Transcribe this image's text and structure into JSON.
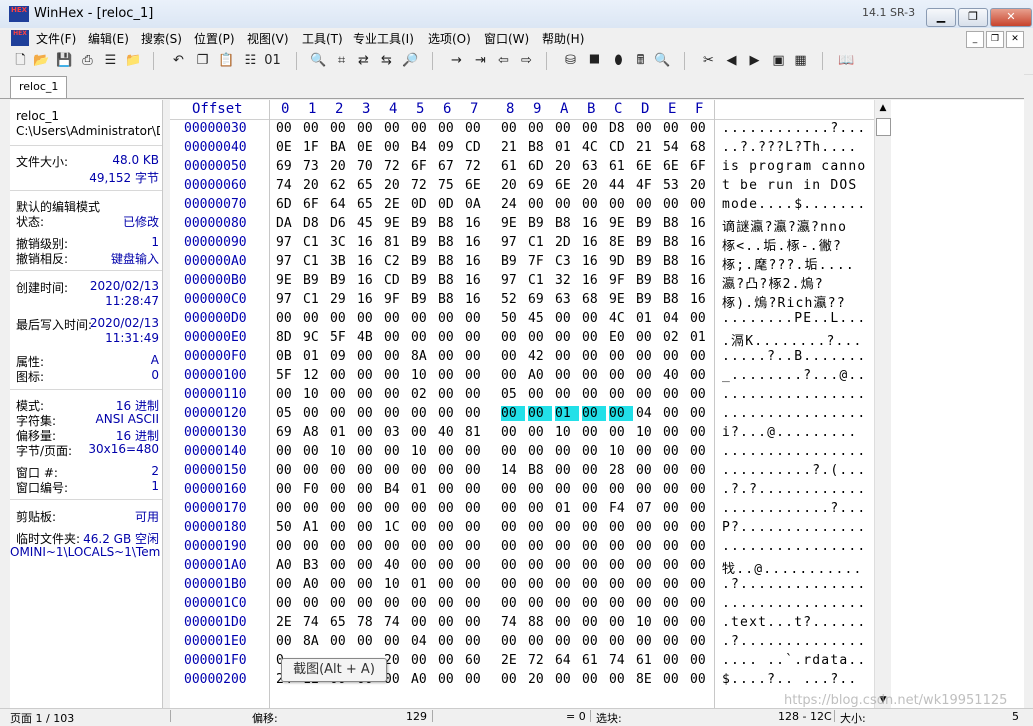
{
  "window": {
    "title": "WinHex - [reloc_1]",
    "version": "14.1 SR-3",
    "icon_text_top": "HEX",
    "icon_text_bottom": "WinHex"
  },
  "menu": [
    "文件(F)",
    "编辑(E)",
    "搜索(S)",
    "位置(P)",
    "视图(V)",
    "工具(T)",
    "专业工具(I)",
    "选项(O)",
    "窗口(W)",
    "帮助(H)"
  ],
  "tab": {
    "label": "reloc_1"
  },
  "info": {
    "filename": "reloc_1",
    "path": "C:\\Users\\Administrator\\De",
    "filesize_label": "文件大小:",
    "filesize_kb": "48.0 KB",
    "filesize_bytes": "49,152 字节",
    "edit_mode_label": "默认的编辑模式",
    "state_label": "状态:",
    "state_value": "已修改",
    "undo_level_label": "撤销级别:",
    "undo_level_value": "1",
    "undo_reverse_label": "撤销相反:",
    "undo_reverse_value": "键盘输入",
    "created_label": "创建时间:",
    "created_date": "2020/02/13",
    "created_time": "11:28:47",
    "modified_label": "最后写入时间:",
    "modified_date": "2020/02/13",
    "modified_time": "11:31:49",
    "attr_label": "属性:",
    "attr_value": "A",
    "icon_label": "图标:",
    "icon_value": "0",
    "mode_label": "模式:",
    "mode_value": "16 进制",
    "charset_label": "字符集:",
    "charset_value": "ANSI ASCII",
    "offset_label": "偏移量:",
    "offset_value": "16 进制",
    "bytes_page_label": "字节/页面:",
    "bytes_page_value": "30x16=480",
    "window_no_label": "窗口 #:",
    "window_no_value": "2",
    "window_num_label": "窗口编号:",
    "window_num_value": "1",
    "clipboard_label": "剪贴板:",
    "clipboard_value": "可用",
    "temp_label": "临时文件夹:",
    "temp_value": "46.2 GB 空闲",
    "temp_path": "OMINI~1\\LOCALS~1\\Temp"
  },
  "hex": {
    "header_offset": "Offset",
    "columns": [
      "0",
      "1",
      "2",
      "3",
      "4",
      "5",
      "6",
      "7",
      "8",
      "9",
      "A",
      "B",
      "C",
      "D",
      "E",
      "F"
    ],
    "rows": [
      {
        "offset": "00000030",
        "bytes": [
          "00",
          "00",
          "00",
          "00",
          "00",
          "00",
          "00",
          "00",
          "00",
          "00",
          "00",
          "00",
          "D8",
          "00",
          "00",
          "00"
        ],
        "ascii": "............?..."
      },
      {
        "offset": "00000040",
        "bytes": [
          "0E",
          "1F",
          "BA",
          "0E",
          "00",
          "B4",
          "09",
          "CD",
          "21",
          "B8",
          "01",
          "4C",
          "CD",
          "21",
          "54",
          "68"
        ],
        "ascii": "..?.???L?Th...."
      },
      {
        "offset": "00000050",
        "bytes": [
          "69",
          "73",
          "20",
          "70",
          "72",
          "6F",
          "67",
          "72",
          "61",
          "6D",
          "20",
          "63",
          "61",
          "6E",
          "6E",
          "6F"
        ],
        "ascii": "is program canno"
      },
      {
        "offset": "00000060",
        "bytes": [
          "74",
          "20",
          "62",
          "65",
          "20",
          "72",
          "75",
          "6E",
          "20",
          "69",
          "6E",
          "20",
          "44",
          "4F",
          "53",
          "20"
        ],
        "ascii": "t be run in DOS "
      },
      {
        "offset": "00000070",
        "bytes": [
          "6D",
          "6F",
          "64",
          "65",
          "2E",
          "0D",
          "0D",
          "0A",
          "24",
          "00",
          "00",
          "00",
          "00",
          "00",
          "00",
          "00"
        ],
        "ascii": "mode....$......."
      },
      {
        "offset": "00000080",
        "bytes": [
          "DA",
          "D8",
          "D6",
          "45",
          "9E",
          "B9",
          "B8",
          "16",
          "9E",
          "B9",
          "B8",
          "16",
          "9E",
          "B9",
          "B8",
          "16"
        ],
        "ascii": "谪謎瀛?瀛?瀛?nno"
      },
      {
        "offset": "00000090",
        "bytes": [
          "97",
          "C1",
          "3C",
          "16",
          "81",
          "B9",
          "B8",
          "16",
          "97",
          "C1",
          "2D",
          "16",
          "8E",
          "B9",
          "B8",
          "16"
        ],
        "ascii": "椓<..垢.椓-.徶?"
      },
      {
        "offset": "000000A0",
        "bytes": [
          "97",
          "C1",
          "3B",
          "16",
          "C2",
          "B9",
          "B8",
          "16",
          "B9",
          "7F",
          "C3",
          "16",
          "9D",
          "B9",
          "B8",
          "16"
        ],
        "ascii": "椓;.麾???.垢...."
      },
      {
        "offset": "000000B0",
        "bytes": [
          "9E",
          "B9",
          "B9",
          "16",
          "CD",
          "B9",
          "B8",
          "16",
          "97",
          "C1",
          "32",
          "16",
          "9F",
          "B9",
          "B8",
          "16"
        ],
        "ascii": "瀛?凸?椓2.熓?"
      },
      {
        "offset": "000000C0",
        "bytes": [
          "97",
          "C1",
          "29",
          "16",
          "9F",
          "B9",
          "B8",
          "16",
          "52",
          "69",
          "63",
          "68",
          "9E",
          "B9",
          "B8",
          "16"
        ],
        "ascii": "椓).熓?Rich瀛??"
      },
      {
        "offset": "000000D0",
        "bytes": [
          "00",
          "00",
          "00",
          "00",
          "00",
          "00",
          "00",
          "00",
          "50",
          "45",
          "00",
          "00",
          "4C",
          "01",
          "04",
          "00"
        ],
        "ascii": "........PE..L..."
      },
      {
        "offset": "000000E0",
        "bytes": [
          "8D",
          "9C",
          "5F",
          "4B",
          "00",
          "00",
          "00",
          "00",
          "00",
          "00",
          "00",
          "00",
          "E0",
          "00",
          "02",
          "01"
        ],
        "ascii": ".滆K........?..."
      },
      {
        "offset": "000000F0",
        "bytes": [
          "0B",
          "01",
          "09",
          "00",
          "00",
          "8A",
          "00",
          "00",
          "00",
          "42",
          "00",
          "00",
          "00",
          "00",
          "00",
          "00"
        ],
        "ascii": ".....?..B......."
      },
      {
        "offset": "00000100",
        "bytes": [
          "5F",
          "12",
          "00",
          "00",
          "00",
          "10",
          "00",
          "00",
          "00",
          "A0",
          "00",
          "00",
          "00",
          "00",
          "40",
          "00"
        ],
        "ascii": "_........?...@.."
      },
      {
        "offset": "00000110",
        "bytes": [
          "00",
          "10",
          "00",
          "00",
          "00",
          "02",
          "00",
          "00",
          "05",
          "00",
          "00",
          "00",
          "00",
          "00",
          "00",
          "00"
        ],
        "ascii": "................"
      },
      {
        "offset": "00000120",
        "bytes": [
          "05",
          "00",
          "00",
          "00",
          "00",
          "00",
          "00",
          "00",
          "00",
          "00",
          "01",
          "00",
          "00",
          "04",
          "00",
          "00"
        ],
        "ascii": "................"
      },
      {
        "offset": "00000130",
        "bytes": [
          "69",
          "A8",
          "01",
          "00",
          "03",
          "00",
          "40",
          "81",
          "00",
          "00",
          "10",
          "00",
          "00",
          "10",
          "00",
          "00"
        ],
        "ascii": "i?...@........."
      },
      {
        "offset": "00000140",
        "bytes": [
          "00",
          "00",
          "10",
          "00",
          "00",
          "10",
          "00",
          "00",
          "00",
          "00",
          "00",
          "00",
          "10",
          "00",
          "00",
          "00"
        ],
        "ascii": "................"
      },
      {
        "offset": "00000150",
        "bytes": [
          "00",
          "00",
          "00",
          "00",
          "00",
          "00",
          "00",
          "00",
          "14",
          "B8",
          "00",
          "00",
          "28",
          "00",
          "00",
          "00"
        ],
        "ascii": "..........?.(..."
      },
      {
        "offset": "00000160",
        "bytes": [
          "00",
          "F0",
          "00",
          "00",
          "B4",
          "01",
          "00",
          "00",
          "00",
          "00",
          "00",
          "00",
          "00",
          "00",
          "00",
          "00"
        ],
        "ascii": ".?.?............"
      },
      {
        "offset": "00000170",
        "bytes": [
          "00",
          "00",
          "00",
          "00",
          "00",
          "00",
          "00",
          "00",
          "00",
          "00",
          "01",
          "00",
          "F4",
          "07",
          "00",
          "00"
        ],
        "ascii": "............?..."
      },
      {
        "offset": "00000180",
        "bytes": [
          "50",
          "A1",
          "00",
          "00",
          "1C",
          "00",
          "00",
          "00",
          "00",
          "00",
          "00",
          "00",
          "00",
          "00",
          "00",
          "00"
        ],
        "ascii": "P?.............."
      },
      {
        "offset": "00000190",
        "bytes": [
          "00",
          "00",
          "00",
          "00",
          "00",
          "00",
          "00",
          "00",
          "00",
          "00",
          "00",
          "00",
          "00",
          "00",
          "00",
          "00"
        ],
        "ascii": "................"
      },
      {
        "offset": "000001A0",
        "bytes": [
          "A0",
          "B3",
          "00",
          "00",
          "40",
          "00",
          "00",
          "00",
          "00",
          "00",
          "00",
          "00",
          "00",
          "00",
          "00",
          "00"
        ],
        "ascii": "牫..@..........."
      },
      {
        "offset": "000001B0",
        "bytes": [
          "00",
          "A0",
          "00",
          "00",
          "10",
          "01",
          "00",
          "00",
          "00",
          "00",
          "00",
          "00",
          "00",
          "00",
          "00",
          "00"
        ],
        "ascii": ".?.............."
      },
      {
        "offset": "000001C0",
        "bytes": [
          "00",
          "00",
          "00",
          "00",
          "00",
          "00",
          "00",
          "00",
          "00",
          "00",
          "00",
          "00",
          "00",
          "00",
          "00",
          "00"
        ],
        "ascii": "................"
      },
      {
        "offset": "000001D0",
        "bytes": [
          "2E",
          "74",
          "65",
          "78",
          "74",
          "00",
          "00",
          "00",
          "74",
          "88",
          "00",
          "00",
          "00",
          "10",
          "00",
          "00"
        ],
        "ascii": ".text...t?......"
      },
      {
        "offset": "000001E0",
        "bytes": [
          "00",
          "8A",
          "00",
          "00",
          "00",
          "04",
          "00",
          "00",
          "00",
          "00",
          "00",
          "00",
          "00",
          "00",
          "00",
          "00"
        ],
        "ascii": ".?.............."
      },
      {
        "offset": "000001F0",
        "bytes": [
          "0",
          "",
          "",
          "",
          "20",
          "00",
          "00",
          "60",
          "2E",
          "72",
          "64",
          "61",
          "74",
          "61",
          "00",
          "00"
        ],
        "ascii": ".... ..`.rdata.."
      },
      {
        "offset": "00000200",
        "bytes": [
          "24",
          "1E",
          "00",
          "00",
          "00",
          "A0",
          "00",
          "00",
          "00",
          "20",
          "00",
          "00",
          "00",
          "8E",
          "00",
          "00"
        ],
        "ascii": "$....?.. ...?.."
      }
    ]
  },
  "tooltip": "截图(Alt + A)",
  "status": {
    "page": "页面 1 / 103",
    "offset_label": "偏移:",
    "offset_value": "129",
    "equal": "= 0",
    "selection_label": "选块:",
    "range": "128 - 12C",
    "size_label": "大小:",
    "size_value": "5"
  },
  "watermark": "https://blog.csdn.net/wk19951125",
  "colors": {
    "selection": "#22e0e8",
    "offset_text": "#0000b0",
    "info_value": "#0000aa"
  }
}
